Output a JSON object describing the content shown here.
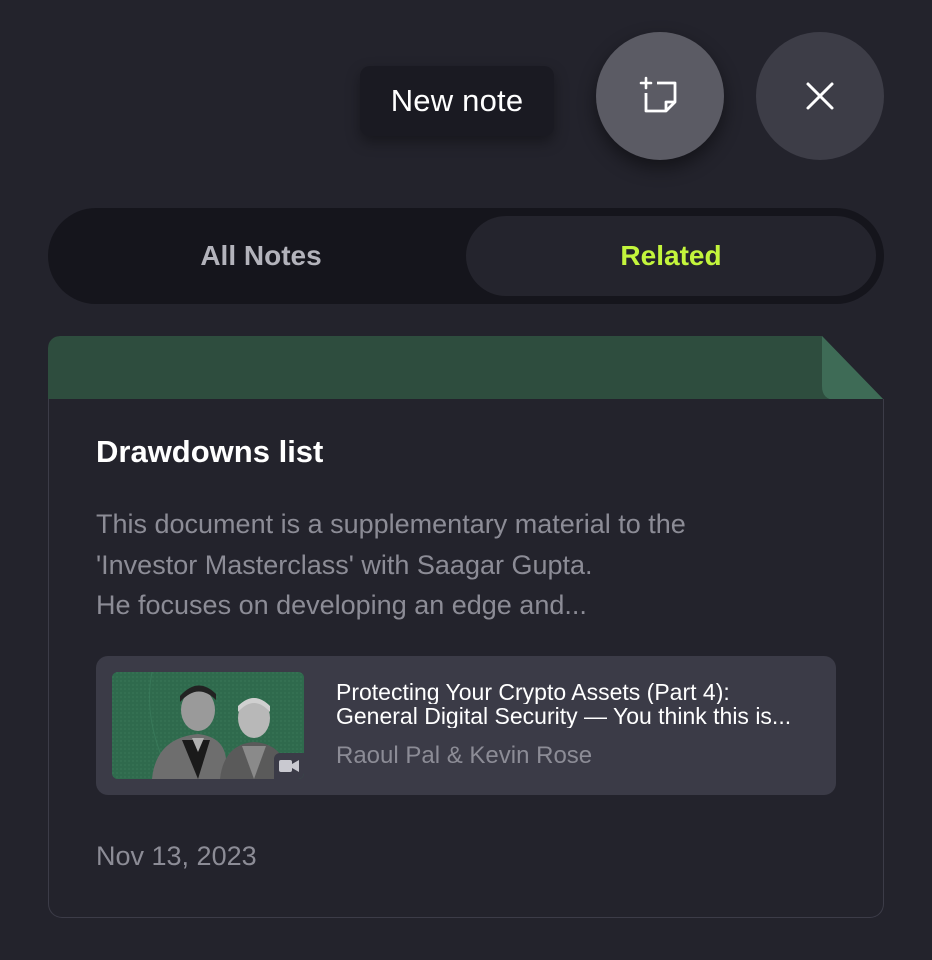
{
  "tooltip": {
    "text": "New note"
  },
  "actions": {
    "new_note_icon": "new-note-icon",
    "close_icon": "close-icon"
  },
  "tabs": [
    {
      "label": "All Notes",
      "active": false
    },
    {
      "label": "Related",
      "active": true
    }
  ],
  "colors": {
    "accent": "#c3f53c",
    "note_header": "#2e4d3e",
    "background": "#23232c"
  },
  "note": {
    "title": "Drawdowns list",
    "excerpt": "This document is a supplementary material to the\n'Investor Masterclass' with Saagar Gupta.\nHe focuses on developing an edge and...",
    "linked": {
      "title_line1": "Protecting Your Crypto Assets (Part 4):",
      "title_line2": "General Digital Security — You think this is...",
      "authors": "Raoul Pal & Kevin Rose",
      "media_icon": "video-camera-icon"
    },
    "date": "Nov 13, 2023"
  }
}
